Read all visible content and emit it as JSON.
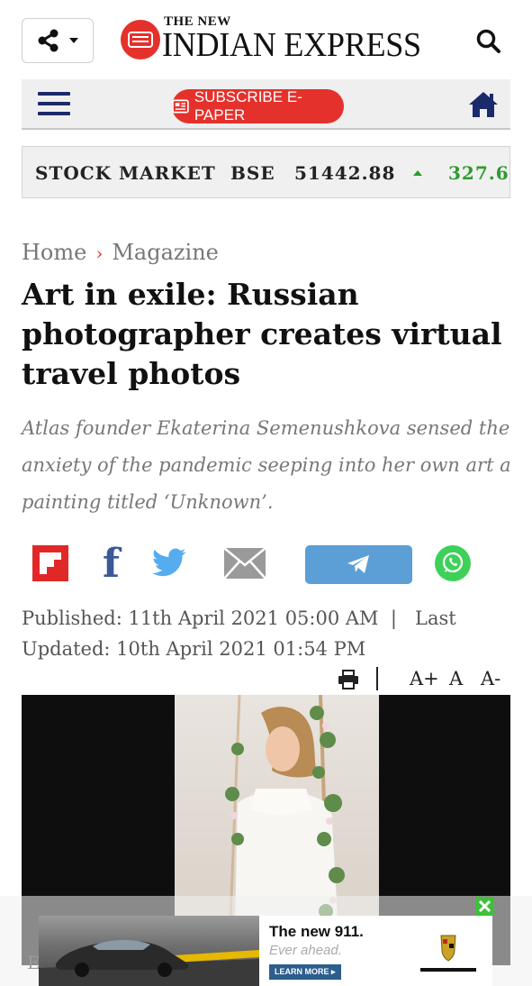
{
  "header": {
    "logo_small": "THE NEW",
    "logo_big": "INDIAN EXPRESS",
    "icons": [
      "share-icon",
      "chevron-down-icon",
      "search-icon"
    ]
  },
  "nav": {
    "subscribe_label": "SUBSCRIBE E-PAPER",
    "icons": [
      "hamburger-menu-icon",
      "newspaper-icon",
      "home-icon"
    ]
  },
  "ticker": {
    "label": "STOCK MARKET",
    "exchange": "BSE",
    "value": "51442.88",
    "change": "327.6",
    "trend": "up",
    "up_color": "#2e9a2e"
  },
  "breadcrumb": {
    "home": "Home",
    "separator": "›",
    "section": "Magazine"
  },
  "article": {
    "title": "Art in exile: Russian photographer creates virtual travel photos",
    "summary": "Atlas founder Ekaterina Semenushkova sensed the anxiety of the pandemic seeping into her own art a painting titled ‘Unknown’.",
    "published": "Published: 11th April 2021 05:00 AM  |   Last Updated: 10th April 2021 01:54 PM",
    "caption_start": "E"
  },
  "share": {
    "icons": [
      "flipboard-icon",
      "facebook-icon",
      "twitter-icon",
      "email-icon",
      "telegram-icon",
      "whatsapp-icon"
    ]
  },
  "tools": {
    "print_icon": "print-icon",
    "separator": "|",
    "font_increase": "A+",
    "font_normal": "A",
    "font_decrease": "A-"
  },
  "ad": {
    "headline": "The new 911.",
    "sub": "Ever ahead.",
    "cta": "LEARN MORE ▸",
    "brand": "PORSCHE"
  },
  "colors": {
    "brand_red": "#e5312b",
    "nav_blue": "#1b2a6b"
  }
}
